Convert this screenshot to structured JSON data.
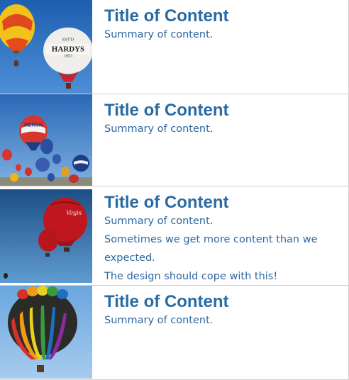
{
  "items": [
    {
      "title": "Title of Content",
      "summary": "Summary of content.",
      "extra": []
    },
    {
      "title": "Title of Content",
      "summary": "Summary of content.",
      "extra": []
    },
    {
      "title": "Title of Content",
      "summary": "Summary of content.",
      "extra": [
        "Sometimes we get more content than we",
        "expected.",
        "The design should cope with this!"
      ]
    },
    {
      "title": "Title of Content",
      "summary": "Summary of content.",
      "extra": []
    }
  ],
  "balloon_text": {
    "hardys_small": "EST'D",
    "hardys": "HARDYS",
    "hardys_year": "1853",
    "cameron": "MERON",
    "virgin": "Virgin"
  }
}
